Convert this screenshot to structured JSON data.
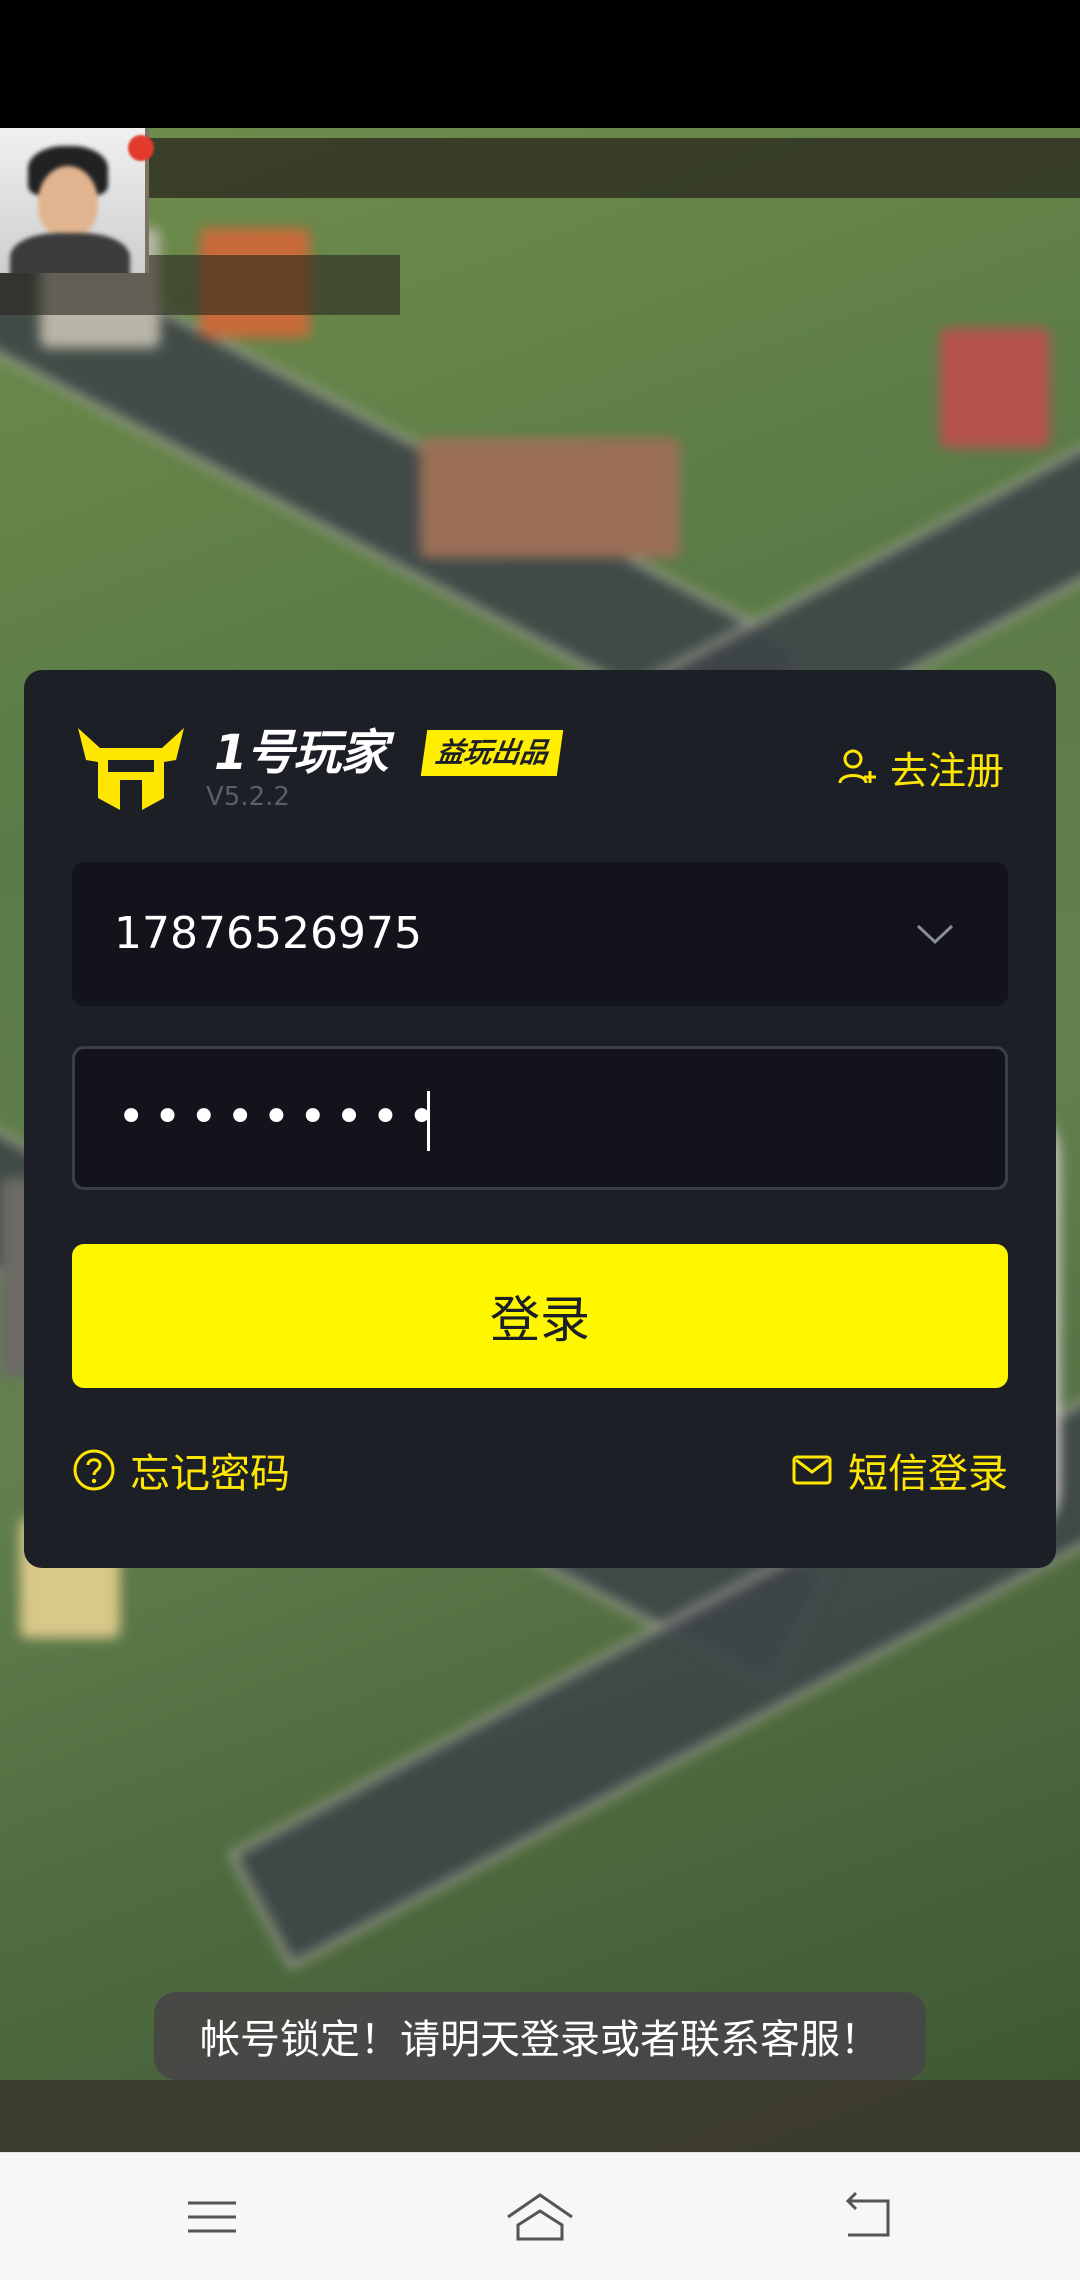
{
  "login": {
    "brand_name": "1号玩家",
    "brand_badge": "益玩出品",
    "version": "V5.2.2",
    "register_label": "去注册",
    "account_value": "17876526975",
    "password_mask": "•••••••••",
    "login_button": "登录",
    "forgot_password": "忘记密码",
    "sms_login": "短信登录"
  },
  "toast": {
    "message": "帐号锁定！请明天登录或者联系客服！"
  },
  "colors": {
    "accent": "#FFF700",
    "card": "#1D1F27",
    "field": "#13141B"
  },
  "icons": {
    "register": "add-user-icon",
    "dropdown": "chevron-down-icon",
    "forgot": "question-circle-icon",
    "sms": "envelope-icon",
    "nav_menu": "menu-icon",
    "nav_home": "home-icon",
    "nav_back": "back-icon"
  }
}
